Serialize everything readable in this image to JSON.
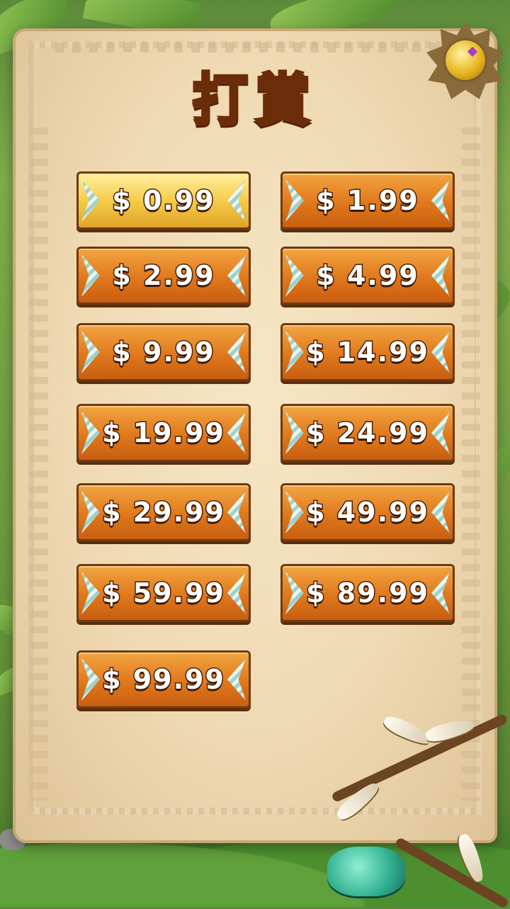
{
  "title": "打賞",
  "buttons": [
    {
      "label": "$ 0.99",
      "style": "gold"
    },
    {
      "label": "$ 1.99",
      "style": "orange"
    },
    {
      "label": "$ 2.99",
      "style": "orange"
    },
    {
      "label": "$ 4.99",
      "style": "orange"
    },
    {
      "label": "$ 9.99",
      "style": "orange"
    },
    {
      "label": "$ 14.99",
      "style": "orange"
    },
    {
      "label": "$ 19.99",
      "style": "orange"
    },
    {
      "label": "$ 24.99",
      "style": "orange"
    },
    {
      "label": "$ 29.99",
      "style": "orange"
    },
    {
      "label": "$ 49.99",
      "style": "orange"
    },
    {
      "label": "$ 59.99",
      "style": "orange"
    },
    {
      "label": "$ 89.99",
      "style": "orange"
    },
    {
      "label": "$ 99.99",
      "style": "orange"
    }
  ],
  "icons": {
    "emblem": "golden-orb-emblem-icon",
    "amulet": "teal-stone-amulet-icon"
  },
  "colors": {
    "button_orange": "#e0781c",
    "button_gold": "#f6cc4a",
    "title_gold": "#ffc02e",
    "panel": "#efd9b2"
  }
}
